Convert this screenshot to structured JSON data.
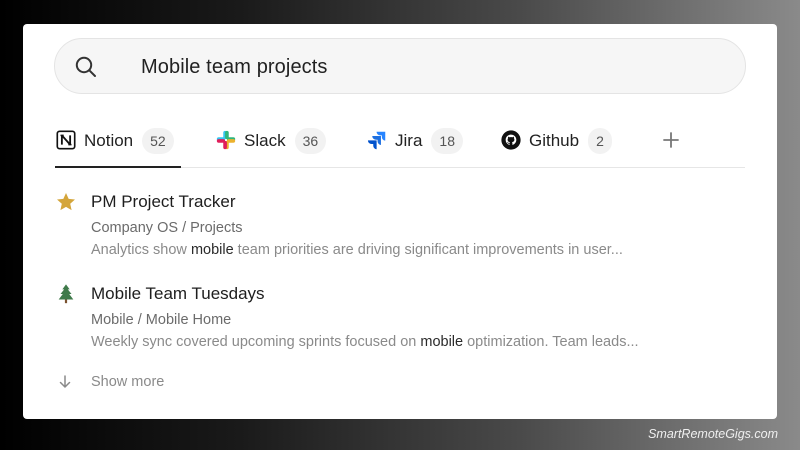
{
  "search": {
    "query": "Mobile team projects",
    "icon": "search-icon"
  },
  "tabs": [
    {
      "label": "Notion",
      "count": "52",
      "icon": "notion-logo-icon",
      "active": true
    },
    {
      "label": "Slack",
      "count": "36",
      "icon": "slack-logo-icon",
      "active": false
    },
    {
      "label": "Jira",
      "count": "18",
      "icon": "jira-logo-icon",
      "active": false
    },
    {
      "label": "Github",
      "count": "2",
      "icon": "github-logo-icon",
      "active": false
    }
  ],
  "add_tab_icon": "plus-icon",
  "results": [
    {
      "icon": "star-icon",
      "title": "PM Project Tracker",
      "path": "Company OS / Projects",
      "snippet_before": "Analytics show ",
      "snippet_highlight": "mobile",
      "snippet_after": " team priorities are driving significant improvements in user..."
    },
    {
      "icon": "evergreen-tree-icon",
      "title": "Mobile Team Tuesdays",
      "path": "Mobile / Mobile Home",
      "snippet_before": "Weekly sync covered upcoming sprints focused on ",
      "snippet_highlight": "mobile",
      "snippet_after": " optimization. Team leads..."
    }
  ],
  "show_more": {
    "label": "Show more",
    "icon": "arrow-down-icon"
  },
  "watermark": "SmartRemoteGigs.com",
  "colors": {
    "star": "#d4a53a",
    "tree": "#3f7a4a",
    "jira": "#2684ff"
  }
}
